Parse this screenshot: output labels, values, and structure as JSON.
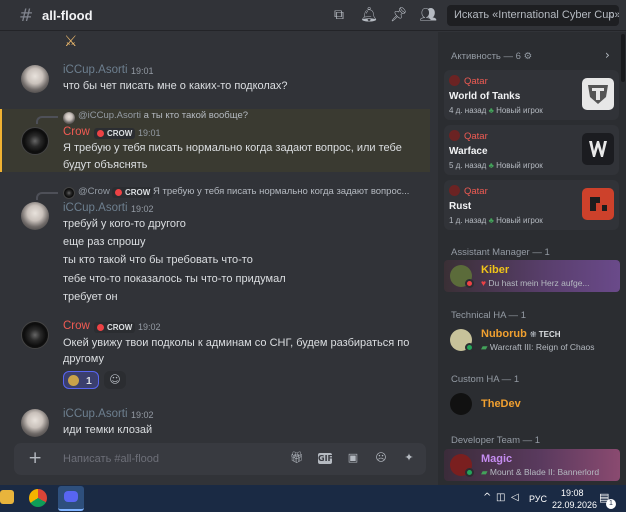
{
  "header": {
    "channel": "all-flood",
    "search_placeholder": "Искать «International Cyber Cup»"
  },
  "messages": [
    {
      "author": "iCCup.Asorti",
      "time": "19:01",
      "lines": [
        "что бы чет писать мне о каких-то подколах?"
      ]
    },
    {
      "reply_author": "@iCCup.Asorti",
      "reply_text": "а ты кто такой вообще?",
      "author": "Crow",
      "badge": "CROW",
      "time": "19:01",
      "lines": [
        "Я требую у тебя писать нормально когда задают вопрос, или тебе",
        "будут объяснять"
      ]
    },
    {
      "reply_author": "@Crow",
      "reply_badge": "CROW",
      "reply_text": "Я требую у тебя писать нормально когда задают вопрос...",
      "author": "iCCup.Asorti",
      "time": "19:02",
      "lines": [
        "требуй у кого-то другого",
        "еще раз спрошу",
        "ты кто такой что бы требовать что-то",
        "тебе что-то показалось ты что-то придумал",
        "требует он"
      ]
    },
    {
      "author": "Crow",
      "badge": "CROW",
      "time": "19:02",
      "lines": [
        "Окей увижу твои подколы к админам со СНГ, будем разбираться по",
        "другому"
      ],
      "reaction_count": "1"
    },
    {
      "author": "iCCup.Asorti",
      "time": "19:02",
      "lines": [
        "иди темки клозай"
      ]
    }
  ],
  "composer": {
    "placeholder": "Написать #all-flood"
  },
  "members": {
    "activity_title": "Активность — 6",
    "activity": [
      {
        "name": "Qatar",
        "game": "World of Tanks",
        "meta": "4 д. назад",
        "new_player": "Новый игрок"
      },
      {
        "name": "Qatar",
        "game": "Warface",
        "meta": "5 д. назад",
        "new_player": "Новый игрок"
      },
      {
        "name": "Qatar",
        "game": "Rust",
        "meta": "1 д. назад",
        "new_player": "Новый игрок"
      }
    ],
    "groups": [
      {
        "title": "Assistant Manager — 1",
        "name": "Kiber",
        "sub": "Du hast mein Herz aufge...",
        "color": "#f0c419"
      },
      {
        "title": "Technical HA — 1",
        "name": "Nuborub",
        "tag": "TECH",
        "sub": "Warcraft III: Reign of Chaos",
        "color": "#f0a030"
      },
      {
        "title": "Custom HA — 1",
        "name": "TheDev",
        "sub": "",
        "color": "#f0a030"
      },
      {
        "title": "Developer Team — 1",
        "name": "Magic",
        "sub": "Mount & Blade II: Bannerlord",
        "color": "#c58cf0"
      }
    ]
  },
  "taskbar": {
    "lang": "РУС",
    "time": "19:08",
    "date": "22.09.2026",
    "notif_count": "1"
  }
}
